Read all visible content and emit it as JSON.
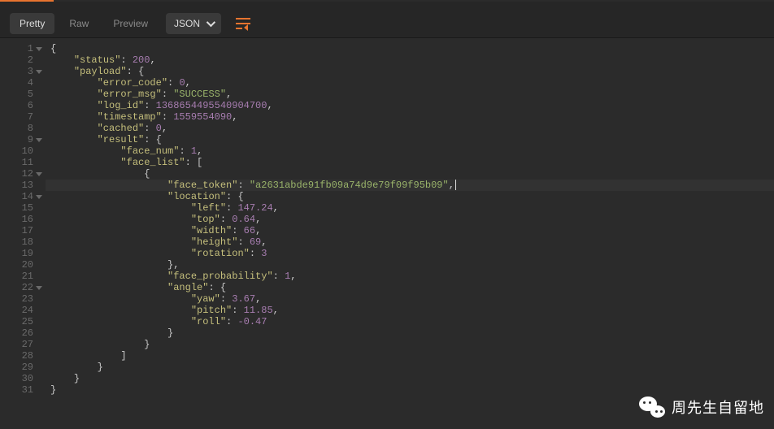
{
  "toolbar": {
    "tabs": {
      "pretty": "Pretty",
      "raw": "Raw",
      "preview": "Preview"
    },
    "format_select": "JSON"
  },
  "watermark": {
    "text": "周先生自留地"
  },
  "code": {
    "lines": [
      [
        {
          "t": "punct",
          "v": "{"
        }
      ],
      [
        {
          "t": "ind",
          "v": 2
        },
        {
          "t": "key",
          "v": "\"status\""
        },
        {
          "t": "punct",
          "v": ": "
        },
        {
          "t": "num",
          "v": "200"
        },
        {
          "t": "punct",
          "v": ","
        }
      ],
      [
        {
          "t": "ind",
          "v": 2
        },
        {
          "t": "key",
          "v": "\"payload\""
        },
        {
          "t": "punct",
          "v": ": {"
        }
      ],
      [
        {
          "t": "ind",
          "v": 4
        },
        {
          "t": "key",
          "v": "\"error_code\""
        },
        {
          "t": "punct",
          "v": ": "
        },
        {
          "t": "num",
          "v": "0"
        },
        {
          "t": "punct",
          "v": ","
        }
      ],
      [
        {
          "t": "ind",
          "v": 4
        },
        {
          "t": "key",
          "v": "\"error_msg\""
        },
        {
          "t": "punct",
          "v": ": "
        },
        {
          "t": "str",
          "v": "\"SUCCESS\""
        },
        {
          "t": "punct",
          "v": ","
        }
      ],
      [
        {
          "t": "ind",
          "v": 4
        },
        {
          "t": "key",
          "v": "\"log_id\""
        },
        {
          "t": "punct",
          "v": ": "
        },
        {
          "t": "num",
          "v": "1368654495540904700"
        },
        {
          "t": "punct",
          "v": ","
        }
      ],
      [
        {
          "t": "ind",
          "v": 4
        },
        {
          "t": "key",
          "v": "\"timestamp\""
        },
        {
          "t": "punct",
          "v": ": "
        },
        {
          "t": "num",
          "v": "1559554090"
        },
        {
          "t": "punct",
          "v": ","
        }
      ],
      [
        {
          "t": "ind",
          "v": 4
        },
        {
          "t": "key",
          "v": "\"cached\""
        },
        {
          "t": "punct",
          "v": ": "
        },
        {
          "t": "num",
          "v": "0"
        },
        {
          "t": "punct",
          "v": ","
        }
      ],
      [
        {
          "t": "ind",
          "v": 4
        },
        {
          "t": "key",
          "v": "\"result\""
        },
        {
          "t": "punct",
          "v": ": {"
        }
      ],
      [
        {
          "t": "ind",
          "v": 6
        },
        {
          "t": "key",
          "v": "\"face_num\""
        },
        {
          "t": "punct",
          "v": ": "
        },
        {
          "t": "num",
          "v": "1"
        },
        {
          "t": "punct",
          "v": ","
        }
      ],
      [
        {
          "t": "ind",
          "v": 6
        },
        {
          "t": "key",
          "v": "\"face_list\""
        },
        {
          "t": "punct",
          "v": ": ["
        }
      ],
      [
        {
          "t": "ind",
          "v": 8
        },
        {
          "t": "punct",
          "v": "{"
        }
      ],
      [
        {
          "t": "ind",
          "v": 10
        },
        {
          "t": "key",
          "v": "\"face_token\""
        },
        {
          "t": "punct",
          "v": ": "
        },
        {
          "t": "str",
          "v": "\"a2631abde91fb09a74d9e79f09f95b09\""
        },
        {
          "t": "punct",
          "v": ","
        },
        {
          "t": "cursor",
          "v": ""
        }
      ],
      [
        {
          "t": "ind",
          "v": 10
        },
        {
          "t": "key",
          "v": "\"location\""
        },
        {
          "t": "punct",
          "v": ": {"
        }
      ],
      [
        {
          "t": "ind",
          "v": 12
        },
        {
          "t": "key",
          "v": "\"left\""
        },
        {
          "t": "punct",
          "v": ": "
        },
        {
          "t": "num",
          "v": "147.24"
        },
        {
          "t": "punct",
          "v": ","
        }
      ],
      [
        {
          "t": "ind",
          "v": 12
        },
        {
          "t": "key",
          "v": "\"top\""
        },
        {
          "t": "punct",
          "v": ": "
        },
        {
          "t": "num",
          "v": "0.64"
        },
        {
          "t": "punct",
          "v": ","
        }
      ],
      [
        {
          "t": "ind",
          "v": 12
        },
        {
          "t": "key",
          "v": "\"width\""
        },
        {
          "t": "punct",
          "v": ": "
        },
        {
          "t": "num",
          "v": "66"
        },
        {
          "t": "punct",
          "v": ","
        }
      ],
      [
        {
          "t": "ind",
          "v": 12
        },
        {
          "t": "key",
          "v": "\"height\""
        },
        {
          "t": "punct",
          "v": ": "
        },
        {
          "t": "num",
          "v": "69"
        },
        {
          "t": "punct",
          "v": ","
        }
      ],
      [
        {
          "t": "ind",
          "v": 12
        },
        {
          "t": "key",
          "v": "\"rotation\""
        },
        {
          "t": "punct",
          "v": ": "
        },
        {
          "t": "num",
          "v": "3"
        }
      ],
      [
        {
          "t": "ind",
          "v": 10
        },
        {
          "t": "punct",
          "v": "},"
        }
      ],
      [
        {
          "t": "ind",
          "v": 10
        },
        {
          "t": "key",
          "v": "\"face_probability\""
        },
        {
          "t": "punct",
          "v": ": "
        },
        {
          "t": "num",
          "v": "1"
        },
        {
          "t": "punct",
          "v": ","
        }
      ],
      [
        {
          "t": "ind",
          "v": 10
        },
        {
          "t": "key",
          "v": "\"angle\""
        },
        {
          "t": "punct",
          "v": ": {"
        }
      ],
      [
        {
          "t": "ind",
          "v": 12
        },
        {
          "t": "key",
          "v": "\"yaw\""
        },
        {
          "t": "punct",
          "v": ": "
        },
        {
          "t": "num",
          "v": "3.67"
        },
        {
          "t": "punct",
          "v": ","
        }
      ],
      [
        {
          "t": "ind",
          "v": 12
        },
        {
          "t": "key",
          "v": "\"pitch\""
        },
        {
          "t": "punct",
          "v": ": "
        },
        {
          "t": "num",
          "v": "11.85"
        },
        {
          "t": "punct",
          "v": ","
        }
      ],
      [
        {
          "t": "ind",
          "v": 12
        },
        {
          "t": "key",
          "v": "\"roll\""
        },
        {
          "t": "punct",
          "v": ": "
        },
        {
          "t": "num",
          "v": "-0.47"
        }
      ],
      [
        {
          "t": "ind",
          "v": 10
        },
        {
          "t": "punct",
          "v": "}"
        }
      ],
      [
        {
          "t": "ind",
          "v": 8
        },
        {
          "t": "punct",
          "v": "}"
        }
      ],
      [
        {
          "t": "ind",
          "v": 6
        },
        {
          "t": "punct",
          "v": "]"
        }
      ],
      [
        {
          "t": "ind",
          "v": 4
        },
        {
          "t": "punct",
          "v": "}"
        }
      ],
      [
        {
          "t": "ind",
          "v": 2
        },
        {
          "t": "punct",
          "v": "}"
        }
      ],
      [
        {
          "t": "punct",
          "v": "}"
        }
      ]
    ],
    "fold_lines": [
      1,
      3,
      9,
      12,
      14,
      22
    ],
    "highlighted_line": 13
  }
}
